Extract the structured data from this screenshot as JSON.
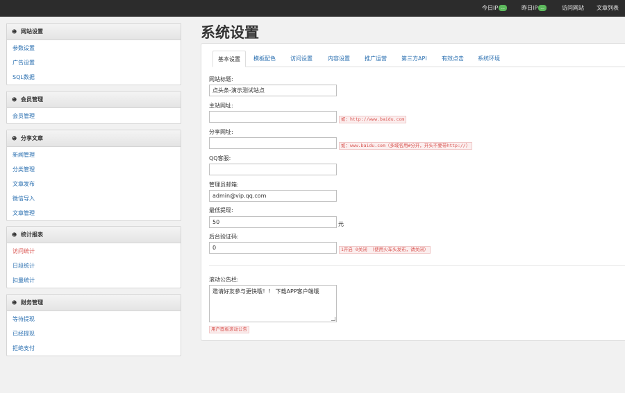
{
  "topbar": {
    "today_ip_label": "今日IP",
    "today_ip_badge": "...",
    "yesterday_ip_label": "昨日IP",
    "yesterday_ip_badge": "...",
    "visit_site": "访问网站",
    "article_list": "文章列表"
  },
  "sidebar": {
    "sections": [
      {
        "title": "网站设置",
        "items": [
          "参数设置",
          "广告设置",
          "SQL数据"
        ]
      },
      {
        "title": "会员管理",
        "items": [
          "会员管理"
        ]
      },
      {
        "title": "分享文章",
        "items": [
          "新闻管理",
          "分类管理",
          "文章发布",
          "微信导入",
          "文章管理"
        ]
      },
      {
        "title": "统计报表",
        "items": [
          "访问统计",
          "日段统计",
          "扣量统计"
        ]
      },
      {
        "title": "财务管理",
        "items": [
          "等待提现",
          "已经提现",
          "拒绝支付"
        ]
      }
    ],
    "active_item": "访问统计"
  },
  "main": {
    "title": "系统设置",
    "tabs": [
      "基本设置",
      "模板配色",
      "访问设置",
      "内容设置",
      "推广运营",
      "第三方API",
      "有效点击",
      "系统环境"
    ],
    "active_tab": "基本设置",
    "fields": {
      "site_title": {
        "label": "网站标题:",
        "value": "点头条-演示测试站点"
      },
      "main_url": {
        "label": "主站网址:",
        "value": "",
        "hint": "如：http://www.baidu.com"
      },
      "share_url": {
        "label": "分享网址:",
        "value": "",
        "hint": "如：www.baidu.com（多域名用#分开，开头不要带http://）"
      },
      "qq_service": {
        "label": "QQ客服:",
        "value": ""
      },
      "admin_email": {
        "label": "管理员邮箱:",
        "value": "admin@vip.qq.com"
      },
      "min_withdraw": {
        "label": "最低提现:",
        "value": "50",
        "unit": "元"
      },
      "captcha": {
        "label": "后台验证码:",
        "value": "0",
        "hint": "1开启 0关闭 （使用火车头发布，请关闭）"
      },
      "notice": {
        "label": "滚动公告栏:",
        "value": "邀请好友参与更快哦！！ 下载APP客户端哦",
        "hint": "用户面板滚动公告"
      }
    }
  },
  "colors": {
    "topbar_bg": "#2c2c2c",
    "link": "#2a6fb0",
    "active_link": "#d9534f",
    "badge": "#5cb85c",
    "hint": "#d9534f"
  }
}
